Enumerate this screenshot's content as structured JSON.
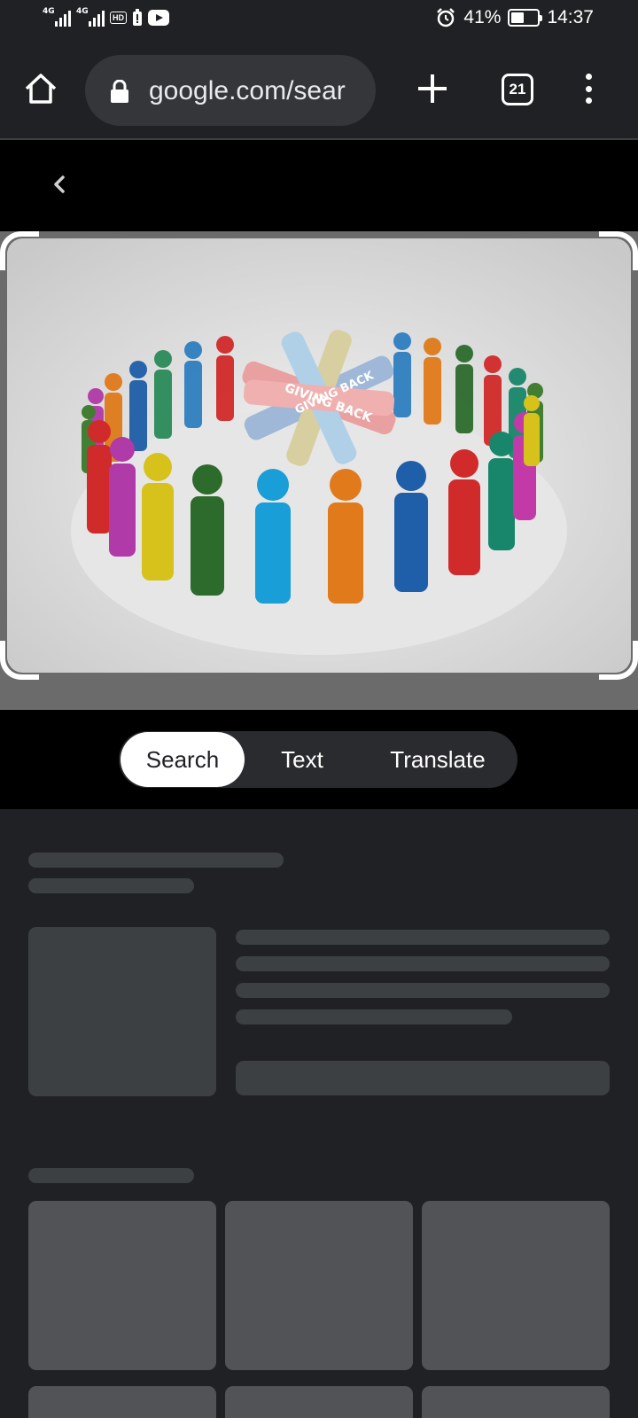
{
  "status_bar": {
    "signal_1": "4G",
    "signal_2": "4G",
    "hd_badge": "HD",
    "battery_percent": "41%",
    "battery_level": 0.41,
    "time": "14:37",
    "icons": [
      "signal-icon",
      "signal-icon",
      "hd-icon",
      "battery-saver-icon",
      "youtube-icon",
      "alarm-icon",
      "battery-icon"
    ]
  },
  "toolbar": {
    "url": "google.com/sear",
    "tab_count": "21"
  },
  "image": {
    "description_icons": [
      "crop-corner-icon"
    ],
    "banner_text": "GIVING BACK"
  },
  "modes": [
    {
      "label": "Search",
      "active": true
    },
    {
      "label": "Text",
      "active": false
    },
    {
      "label": "Translate",
      "active": false
    }
  ],
  "colors": {
    "background": "#202124",
    "skeleton": "#3c4043",
    "tile": "#515357",
    "active_mode": "#ffffff"
  }
}
